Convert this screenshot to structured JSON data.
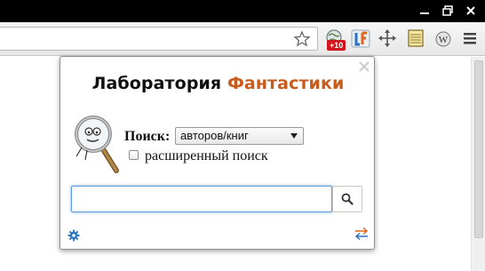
{
  "window": {
    "controls": [
      "minimize-icon",
      "maximize-icon",
      "close-icon"
    ]
  },
  "toolbar": {
    "extensions": [
      "globe-icon",
      "fantlab-icon",
      "move-arrows-icon",
      "notes-icon",
      "wiki-icon",
      "menu-icon"
    ],
    "badge": "+10"
  },
  "popup": {
    "title_part1": "Лаборатория",
    "title_part2": "Фантастики",
    "title_accent_color": "#c85c1e",
    "search_label": "Поиск:",
    "search_type": {
      "selected": "авторов/книг"
    },
    "advanced_label": "расширенный поиск",
    "advanced_checked": false,
    "query_value": "",
    "footer_icons": [
      "gear-icon",
      "swap-arrows-icon"
    ]
  }
}
